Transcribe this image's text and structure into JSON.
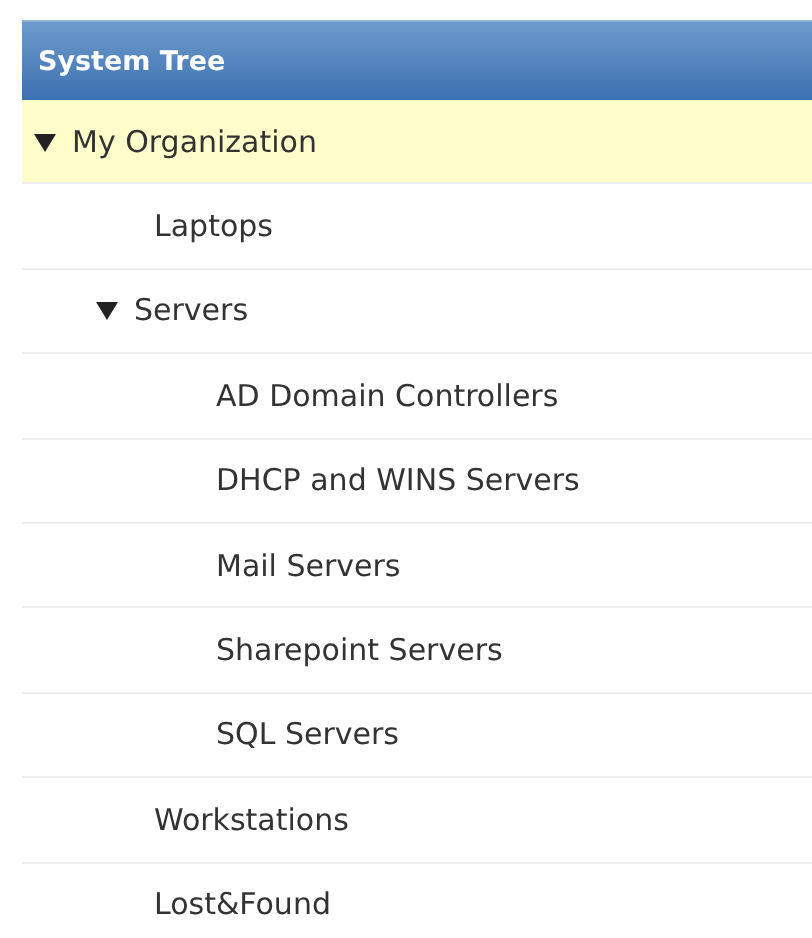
{
  "panel": {
    "title": "System Tree"
  },
  "tree": [
    {
      "label": "My Organization",
      "selected": true,
      "expanded": true,
      "children": [
        {
          "label": "Laptops",
          "selected": false
        },
        {
          "label": "Servers",
          "selected": false,
          "expanded": true,
          "children": [
            {
              "label": "AD Domain Controllers",
              "selected": false
            },
            {
              "label": "DHCP and WINS Servers",
              "selected": false
            },
            {
              "label": "Mail Servers",
              "selected": false
            },
            {
              "label": "Sharepoint Servers",
              "selected": false
            },
            {
              "label": "SQL Servers",
              "selected": false
            }
          ]
        },
        {
          "label": "Workstations",
          "selected": false
        },
        {
          "label": "Lost&Found",
          "selected": false
        }
      ]
    }
  ]
}
